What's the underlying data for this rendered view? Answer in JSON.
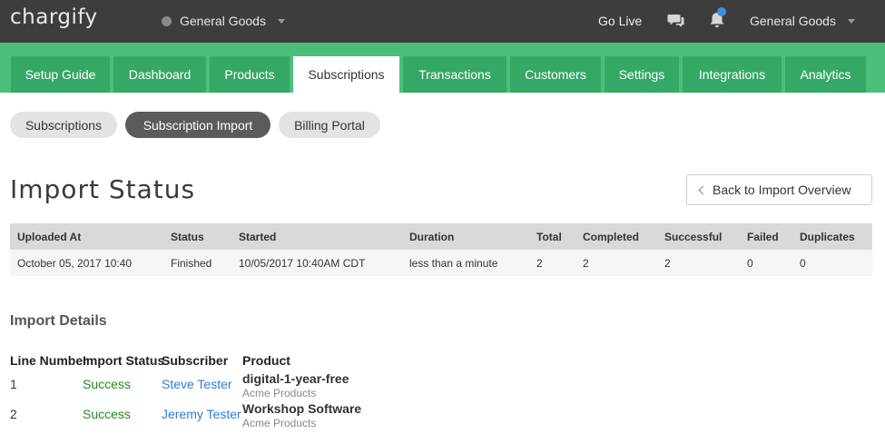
{
  "header": {
    "logo": "chargify",
    "site_name": "General Goods",
    "go_live": "Go Live",
    "account_name": "General Goods",
    "icons": [
      "chat-icon",
      "bell-icon",
      "chevron-down-icon"
    ],
    "badge_color": "#3a8fe0"
  },
  "nav": {
    "tabs": [
      {
        "label": "Setup Guide"
      },
      {
        "label": "Dashboard"
      },
      {
        "label": "Products"
      },
      {
        "label": "Subscriptions"
      },
      {
        "label": "Transactions"
      },
      {
        "label": "Customers"
      },
      {
        "label": "Settings"
      },
      {
        "label": "Integrations"
      },
      {
        "label": "Analytics"
      }
    ],
    "active": "Subscriptions",
    "colors": {
      "band": "#4bbf7a",
      "tab": "#35a865"
    }
  },
  "subnav": {
    "items": [
      {
        "label": "Subscriptions"
      },
      {
        "label": "Subscription Import"
      },
      {
        "label": "Billing Portal"
      }
    ],
    "active": "Subscription Import"
  },
  "page": {
    "title": "Import Status",
    "back_button": "Back to Import Overview"
  },
  "status_table": {
    "headers": [
      "Uploaded At",
      "Status",
      "Started",
      "Duration",
      "Total",
      "Completed",
      "Successful",
      "Failed",
      "Duplicates"
    ],
    "row": [
      "October 05, 2017 10:40",
      "Finished",
      "10/05/2017 10:40AM CDT",
      "less than a minute",
      "2",
      "2",
      "2",
      "0",
      "0"
    ]
  },
  "details": {
    "title": "Import Details",
    "headers": [
      "Line Number",
      "Import Status",
      "Subscriber",
      "Product"
    ],
    "rows": [
      {
        "line": "1",
        "status": "Success",
        "subscriber": "Steve Tester",
        "product": "digital-1-year-free",
        "product_family": "Acme Products"
      },
      {
        "line": "2",
        "status": "Success",
        "subscriber": "Jeremy Tester",
        "product": "Workshop Software",
        "product_family": "Acme Products"
      }
    ]
  }
}
